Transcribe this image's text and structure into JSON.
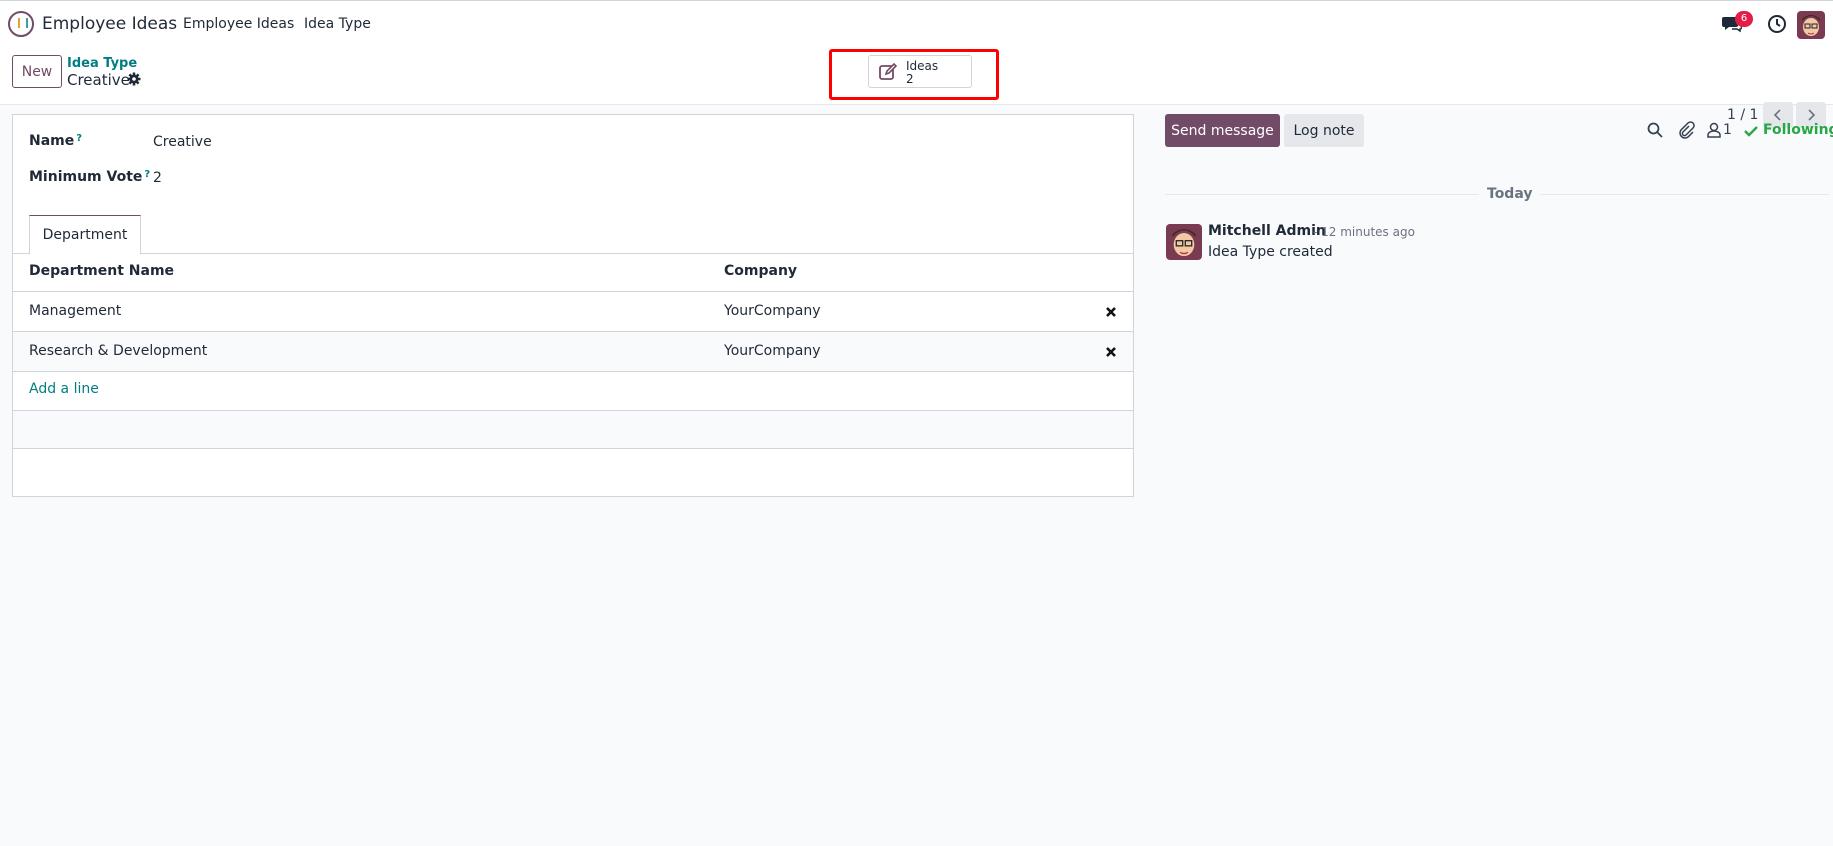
{
  "topbar": {
    "app_name": "Employee Ideas",
    "menu": [
      "Employee Ideas",
      "Idea Type"
    ],
    "messages_badge": "6"
  },
  "control": {
    "new_label": "New",
    "breadcrumb_parent": "Idea Type",
    "breadcrumb_current": "Creative",
    "stat_button": {
      "label": "Ideas",
      "value": "2"
    },
    "pager": "1 / 1"
  },
  "form": {
    "name_label": "Name",
    "name_value": "Creative",
    "min_vote_label": "Minimum Vote",
    "min_vote_value": "2",
    "help_mark": "?",
    "tab_label": "Department",
    "columns": [
      "Department Name",
      "Company"
    ],
    "rows": [
      {
        "department": "Management",
        "company": "YourCompany"
      },
      {
        "department": "Research & Development",
        "company": "YourCompany"
      }
    ],
    "add_line": "Add a line"
  },
  "chatter": {
    "send_message": "Send message",
    "log_note": "Log note",
    "followers": "1",
    "following": "Following",
    "date_separator": "Today",
    "messages": [
      {
        "author": "Mitchell Admin",
        "time": "- 12 minutes ago",
        "body": "Idea Type created"
      }
    ]
  },
  "colors": {
    "brand": "#714B67",
    "link": "#017e84",
    "following": "#28a745",
    "highlight": "#ff0000"
  }
}
